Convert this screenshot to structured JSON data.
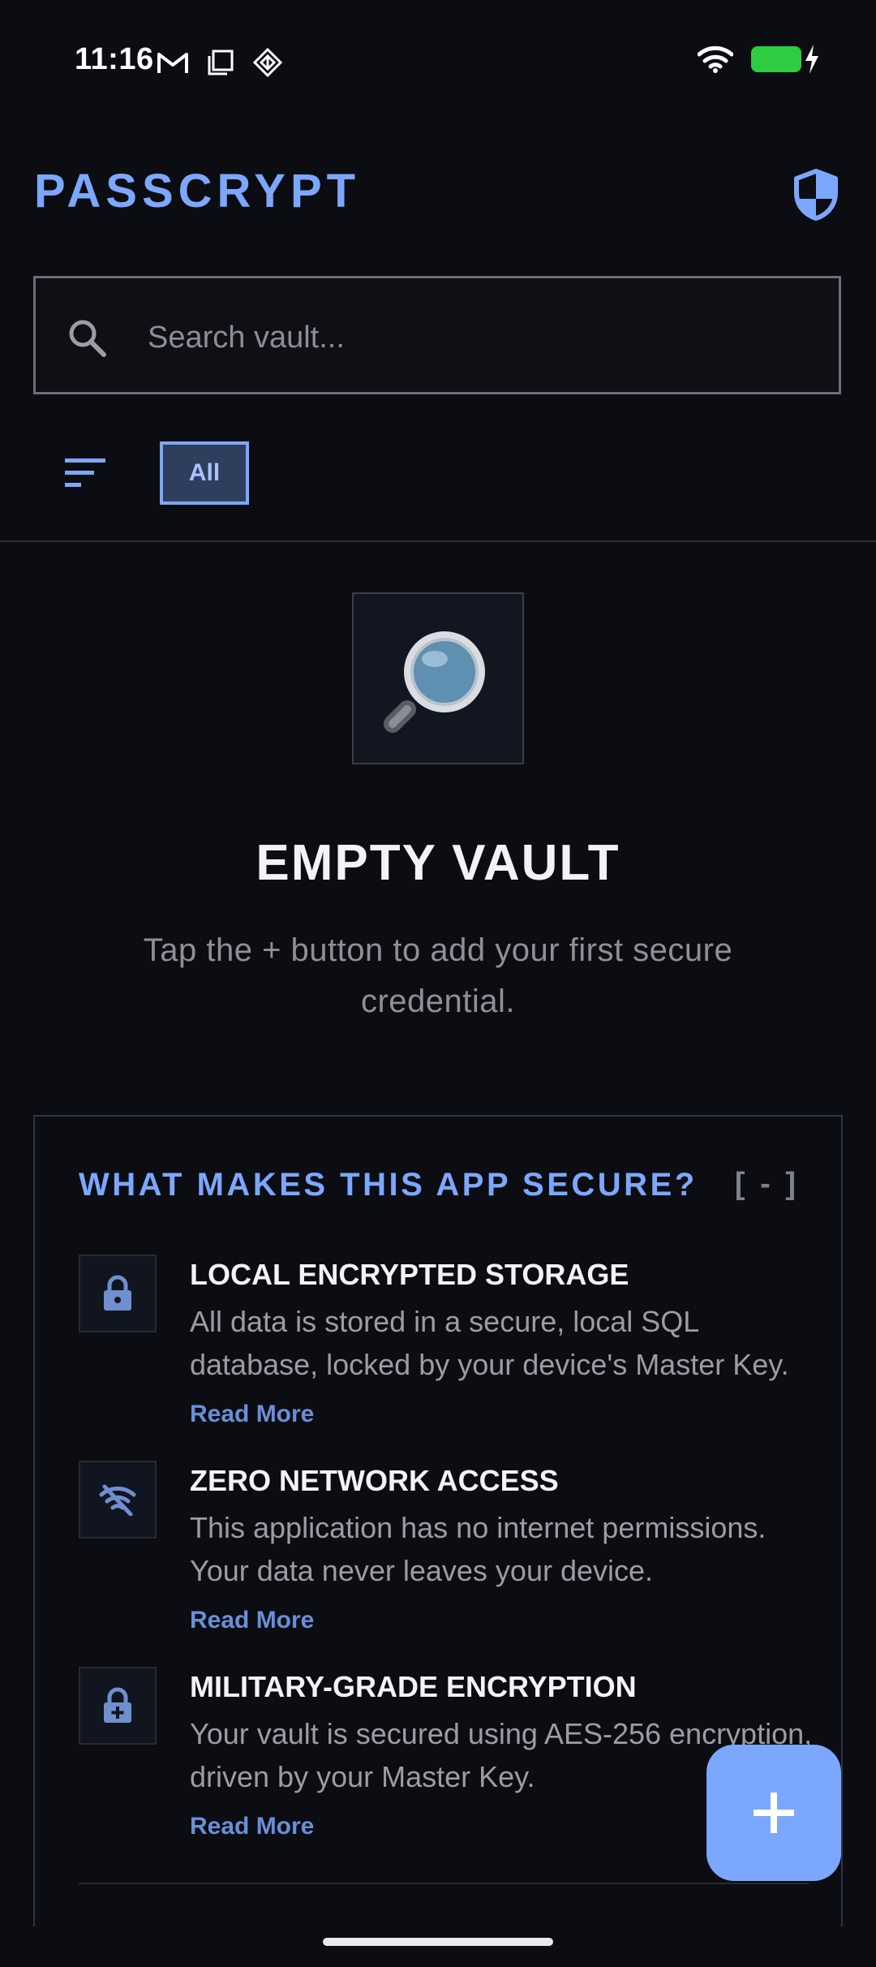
{
  "status_bar": {
    "time": "11:16",
    "left_icons": [
      "gmail-icon",
      "screenshot-icon",
      "app-icon"
    ],
    "right_icons": [
      "wifi-icon",
      "battery-charging-icon"
    ],
    "battery_color": "#2ecc40"
  },
  "header": {
    "title": "PASSCRYPT",
    "shield_icon": "shield-icon",
    "accent": "#7ca7ff"
  },
  "search": {
    "placeholder": "Search vault...",
    "value": ""
  },
  "filters": {
    "sort_icon": "sort-icon",
    "chips": [
      {
        "label": "All",
        "selected": true
      }
    ]
  },
  "empty_state": {
    "icon": "magnifying-glass-icon",
    "title": "EMPTY VAULT",
    "description": "Tap the + button to add your first secure credential."
  },
  "security": {
    "title": "WHAT MAKES THIS APP SECURE?",
    "toggle_label": "[ - ]",
    "features": [
      {
        "icon": "lock-icon",
        "title": "LOCAL ENCRYPTED STORAGE",
        "description": "All data is stored in a secure, local SQL database, locked by your device's Master Key.",
        "link": "Read More"
      },
      {
        "icon": "wifi-off-icon",
        "title": "ZERO NETWORK ACCESS",
        "description": "This application has no internet permissions. Your data never leaves your device.",
        "link": "Read More"
      },
      {
        "icon": "enhanced-encryption-icon",
        "title": "MILITARY-GRADE ENCRYPTION",
        "description": "Your vault is secured using AES-256 encryption, driven by your Master Key.",
        "link": "Read More"
      }
    ]
  },
  "fab": {
    "icon": "plus-icon"
  }
}
